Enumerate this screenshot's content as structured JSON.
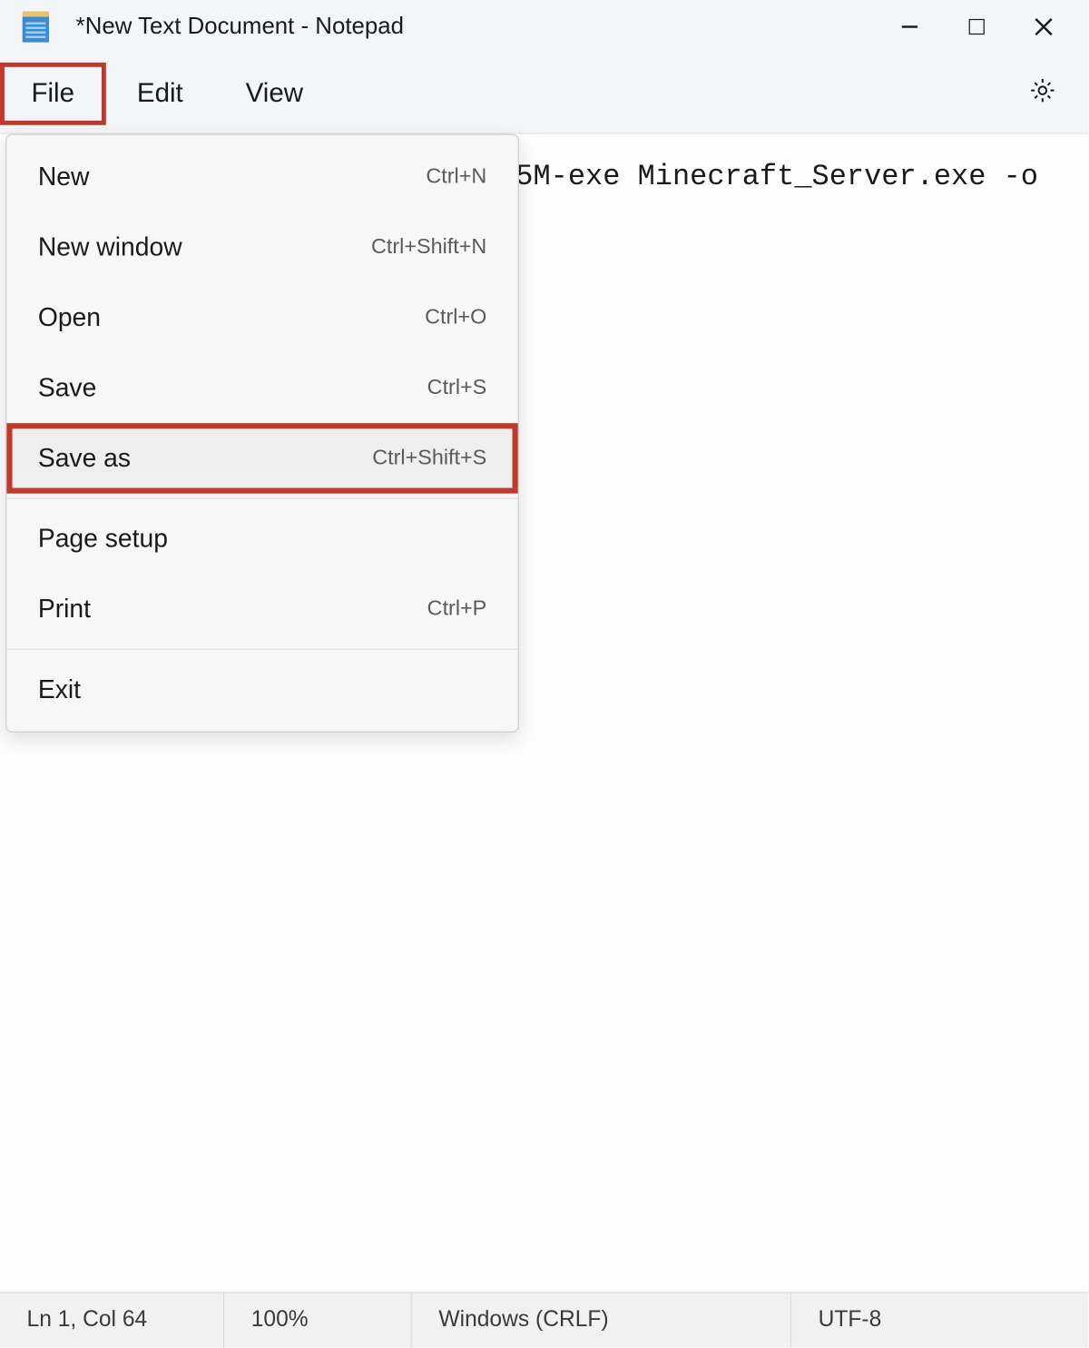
{
  "window": {
    "title": "*New Text Document - Notepad"
  },
  "menubar": {
    "items": [
      {
        "label": "File",
        "active": true
      },
      {
        "label": "Edit",
        "active": false
      },
      {
        "label": "View",
        "active": false
      }
    ]
  },
  "editor": {
    "visible_text": "5M-exe Minecraft_Server.exe -o"
  },
  "file_menu": {
    "items": [
      {
        "label": "New",
        "shortcut": "Ctrl+N",
        "highlighted": false,
        "separator_after": false
      },
      {
        "label": "New window",
        "shortcut": "Ctrl+Shift+N",
        "highlighted": false,
        "separator_after": false
      },
      {
        "label": "Open",
        "shortcut": "Ctrl+O",
        "highlighted": false,
        "separator_after": false
      },
      {
        "label": "Save",
        "shortcut": "Ctrl+S",
        "highlighted": false,
        "separator_after": false
      },
      {
        "label": "Save as",
        "shortcut": "Ctrl+Shift+S",
        "highlighted": true,
        "separator_after": true
      },
      {
        "label": "Page setup",
        "shortcut": "",
        "highlighted": false,
        "separator_after": false
      },
      {
        "label": "Print",
        "shortcut": "Ctrl+P",
        "highlighted": false,
        "separator_after": true
      },
      {
        "label": "Exit",
        "shortcut": "",
        "highlighted": false,
        "separator_after": false
      }
    ]
  },
  "statusbar": {
    "cursor": "Ln 1, Col 64",
    "zoom": "100%",
    "line_ending": "Windows (CRLF)",
    "encoding": "UTF-8"
  },
  "highlight_color": "#c0392b"
}
